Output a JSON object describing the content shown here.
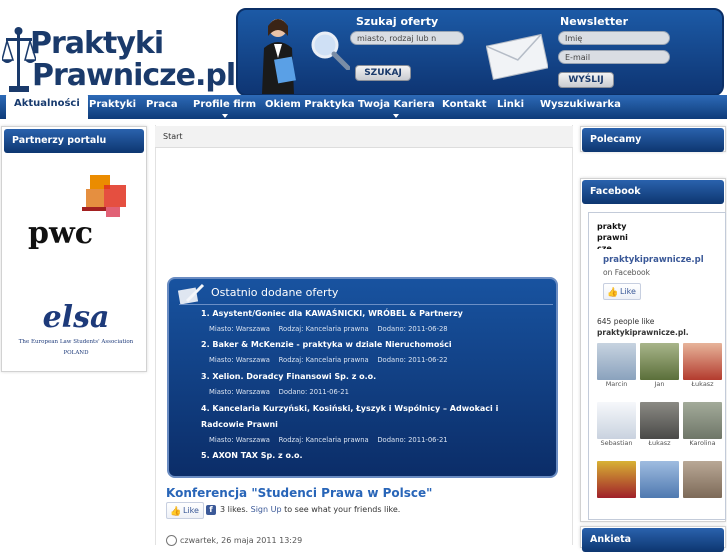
{
  "header": {
    "logo_line1": "Praktyki",
    "logo_line2": "Prawnicze.pl",
    "search": {
      "title": "Szukaj oferty",
      "placeholder": "miasto, rodzaj lub n",
      "button": "SZUKAJ"
    },
    "newsletter": {
      "title": "Newsletter",
      "name_placeholder": "Imię",
      "email_placeholder": "E-mail",
      "button": "WYŚLIJ"
    }
  },
  "nav": {
    "items": [
      "Aktualności",
      "Praktyki",
      "Praca",
      "Profile firm",
      "Okiem Praktyka",
      "Twoja Kariera",
      "Kontakt",
      "Linki",
      "Wyszukiwarka"
    ],
    "active": "Aktualności"
  },
  "left": {
    "title": "Partnerzy portalu",
    "partners": [
      {
        "logo": "pwc",
        "colors": [
          "#dc6900",
          "#e0301e",
          "#eb8c00",
          "#d93954",
          "#a32020"
        ]
      },
      {
        "logo": "elsa",
        "tagline": "The European Law Students' Association",
        "country": "POLAND"
      }
    ]
  },
  "main": {
    "breadcrumb": "Start",
    "offers": {
      "title": "Ostatnio dodane oferty",
      "items": [
        {
          "title": "1. Asystent/Goniec dla KAWAŚNICKI, WRÓBEL & Partnerzy",
          "meta": "Miasto: Warszawa    Rodzaj: Kancelaria prawna    Dodano: 2011-06-28"
        },
        {
          "title": "2. Baker & McKenzie - praktyka w dziale Nieruchomości",
          "meta": "Miasto: Warszawa    Rodzaj: Kancelaria prawna    Dodano: 2011-06-22"
        },
        {
          "title": "3. Xelion. Doradcy Finansowi Sp. z o.o.",
          "meta": "Miasto: Warszawa    Dodano: 2011-06-21"
        },
        {
          "title": "4. Kancelaria Kurzyński, Kosiński, Łyszyk i Wspólnicy – Adwokaci i",
          "title2": "Radcowie Prawni",
          "meta": "Miasto: Warszawa    Rodzaj: Kancelaria prawna    Dodano: 2011-06-21"
        },
        {
          "title": "5. AXON TAX Sp. z o.o."
        }
      ]
    },
    "article": {
      "title": "Konferencja \"Studenci Prawa w Polsce\"",
      "like_button": "Like",
      "likes_text": "3 likes.",
      "signup": "Sign Up",
      "signup_suffix": "to see what your friends like.",
      "date": "czwartek, 26 maja 2011 13:29"
    }
  },
  "right": {
    "polecamy": "Polecamy",
    "facebook": {
      "title": "Facebook",
      "page_logo": "praktyprawnicze",
      "page_name": "praktykiprawnicze.pl",
      "on_facebook": "on Facebook",
      "like_button": "Like",
      "count_text": "645 people like",
      "count_page": "praktykiprawnicze.pl.",
      "friends": [
        {
          "name": "Marcin",
          "color": "#8aa2bd"
        },
        {
          "name": "Jan",
          "color": "#5b6f3a"
        },
        {
          "name": "Łukasz",
          "color": "#b33b2e"
        },
        {
          "name": "Sebastian",
          "color": "#e8ecf2"
        },
        {
          "name": "Łukasz",
          "color": "#4a4a48"
        },
        {
          "name": "Karolina",
          "color": "#6f7668"
        },
        {
          "name": "",
          "color": "#a0202a"
        },
        {
          "name": "",
          "color": "#4f79b0"
        },
        {
          "name": "",
          "color": "#7d6a58"
        }
      ]
    },
    "ankieta": "Ankieta"
  }
}
